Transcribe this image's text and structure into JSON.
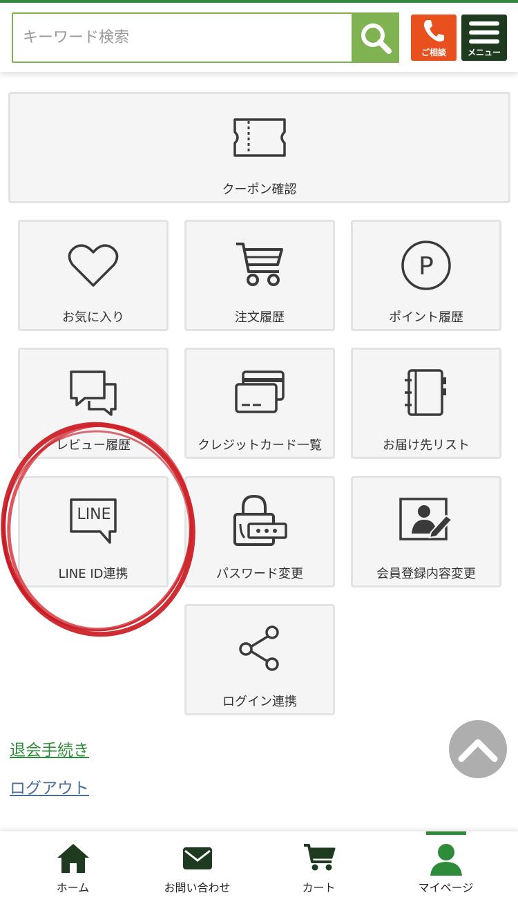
{
  "header": {
    "search_placeholder": "キーワード検索",
    "consult_label": "ご相談",
    "menu_label": "メニュー",
    "accent_color": "#7fb251",
    "consult_color": "#e8501e",
    "menu_color": "#1f3b1f"
  },
  "tiles": {
    "coupon": "クーポン確認",
    "favorites": "お気に入り",
    "orders": "注文履歴",
    "points": "ポイント履歴",
    "reviews": "レビュー履歴",
    "cards": "クレジットカード一覧",
    "addresses": "お届け先リスト",
    "line": "LINE ID連携",
    "line_icon_text": "LINE",
    "password": "パスワード変更",
    "profile": "会員登録内容変更",
    "social": "ログイン連携"
  },
  "links": {
    "withdraw": "退会手続き",
    "logout": "ログアウト"
  },
  "bottom_nav": {
    "home": "ホーム",
    "contact": "お問い合わせ",
    "cart": "カート",
    "mypage": "マイページ",
    "active": "マイページ"
  }
}
